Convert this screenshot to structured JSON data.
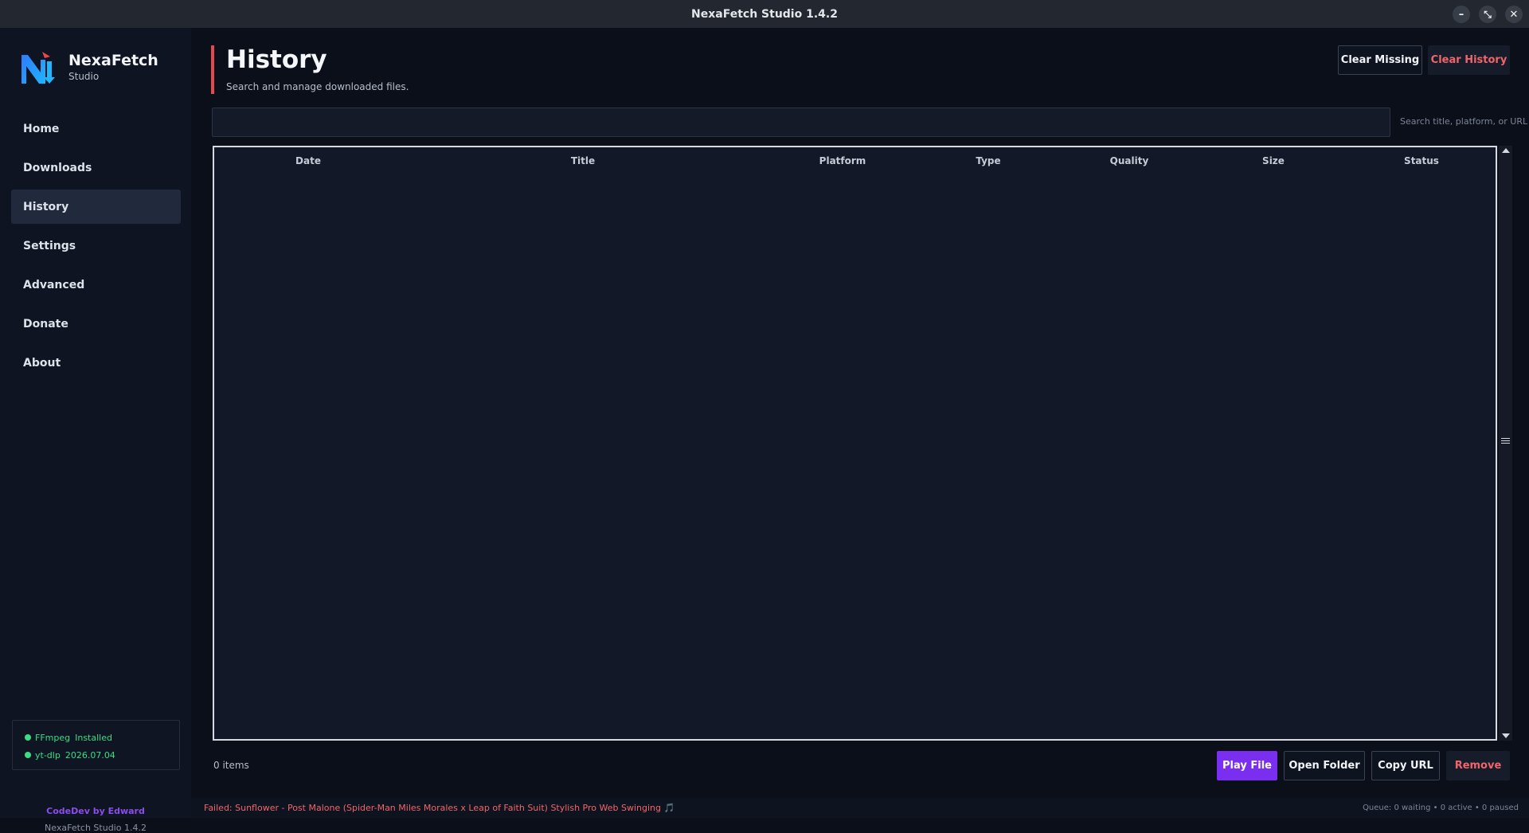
{
  "window": {
    "title": "NexaFetch Studio 1.4.2",
    "controls": [
      {
        "name": "minimize-icon",
        "glyph": "–"
      },
      {
        "name": "restore-icon",
        "glyph": "⤡"
      },
      {
        "name": "close-icon",
        "glyph": "✕"
      }
    ]
  },
  "sidebar": {
    "brand": {
      "name": "NexaFetch",
      "subtitle": "Studio",
      "logo_icon": "nexafetch-logo-icon"
    },
    "items": [
      {
        "label": "Home",
        "active": false
      },
      {
        "label": "Downloads",
        "active": false
      },
      {
        "label": "History",
        "active": true
      },
      {
        "label": "Settings",
        "active": false
      },
      {
        "label": "Advanced",
        "active": false
      },
      {
        "label": "Donate",
        "active": false
      },
      {
        "label": "About",
        "active": false
      }
    ],
    "dependencies": [
      {
        "name": "FFmpeg",
        "status": "Installed"
      },
      {
        "name": "yt-dlp",
        "status": "2026.07.04"
      }
    ],
    "credit": "CodeDev by Edward",
    "version": "NexaFetch Studio 1.4.2"
  },
  "header": {
    "title": "History",
    "subtitle": "Search and manage downloaded files.",
    "clear_missing_label": "Clear Missing",
    "clear_history_label": "Clear History"
  },
  "search": {
    "value": "",
    "hint": "Search title, platform, or URL"
  },
  "table": {
    "columns": [
      "Date",
      "Title",
      "Platform",
      "Type",
      "Quality",
      "Size",
      "Status"
    ],
    "rows": []
  },
  "footer": {
    "item_count": "0 items",
    "play_label": "Play File",
    "open_folder_label": "Open Folder",
    "copy_url_label": "Copy URL",
    "remove_label": "Remove"
  },
  "statusbar": {
    "message": "Failed: Sunflower - Post Malone (Spider-Man Miles Morales x Leap of Faith Suit) Stylish Pro Web Swinging 🎵",
    "queue": "Queue: 0 waiting • 0 active • 0 paused"
  },
  "colors": {
    "accent": "#7a2ff0",
    "danger": "#f0656b",
    "success": "#3ddc84",
    "header_accent": "#e5484d"
  }
}
